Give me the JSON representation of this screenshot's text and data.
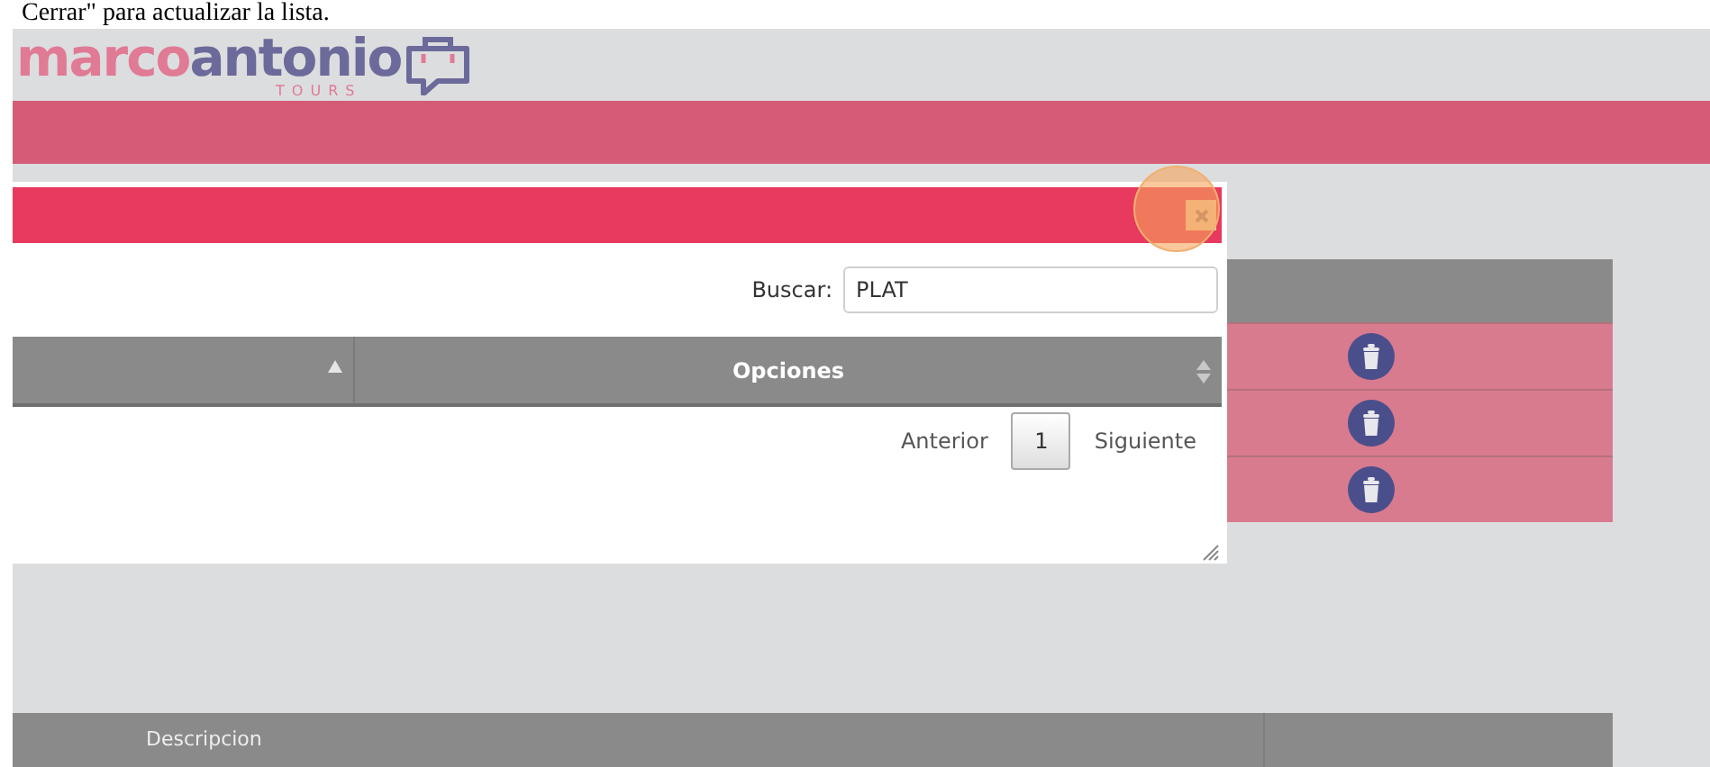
{
  "caption": "Cerrar\" para actualizar la lista.",
  "logo": {
    "part_1": "marco",
    "part_2": "antonio",
    "tagline": "TOURS"
  },
  "background_table": {
    "rows": [
      {
        "kind": "delete"
      },
      {
        "kind": "delete"
      },
      {
        "kind": "delete"
      }
    ]
  },
  "modal": {
    "close_highlighted": true,
    "search": {
      "label": "Buscar:",
      "value": "PLAT"
    },
    "columns": [
      {
        "kind": "sort_asc"
      },
      {
        "label": "Opciones",
        "kind": "sort_both"
      }
    ],
    "pagination": {
      "previous": "Anterior",
      "pages": [
        {
          "label": "1",
          "selected": true
        }
      ],
      "next": "Siguiente"
    }
  },
  "bottom_table": {
    "columns": [
      "Descripcion"
    ]
  }
}
